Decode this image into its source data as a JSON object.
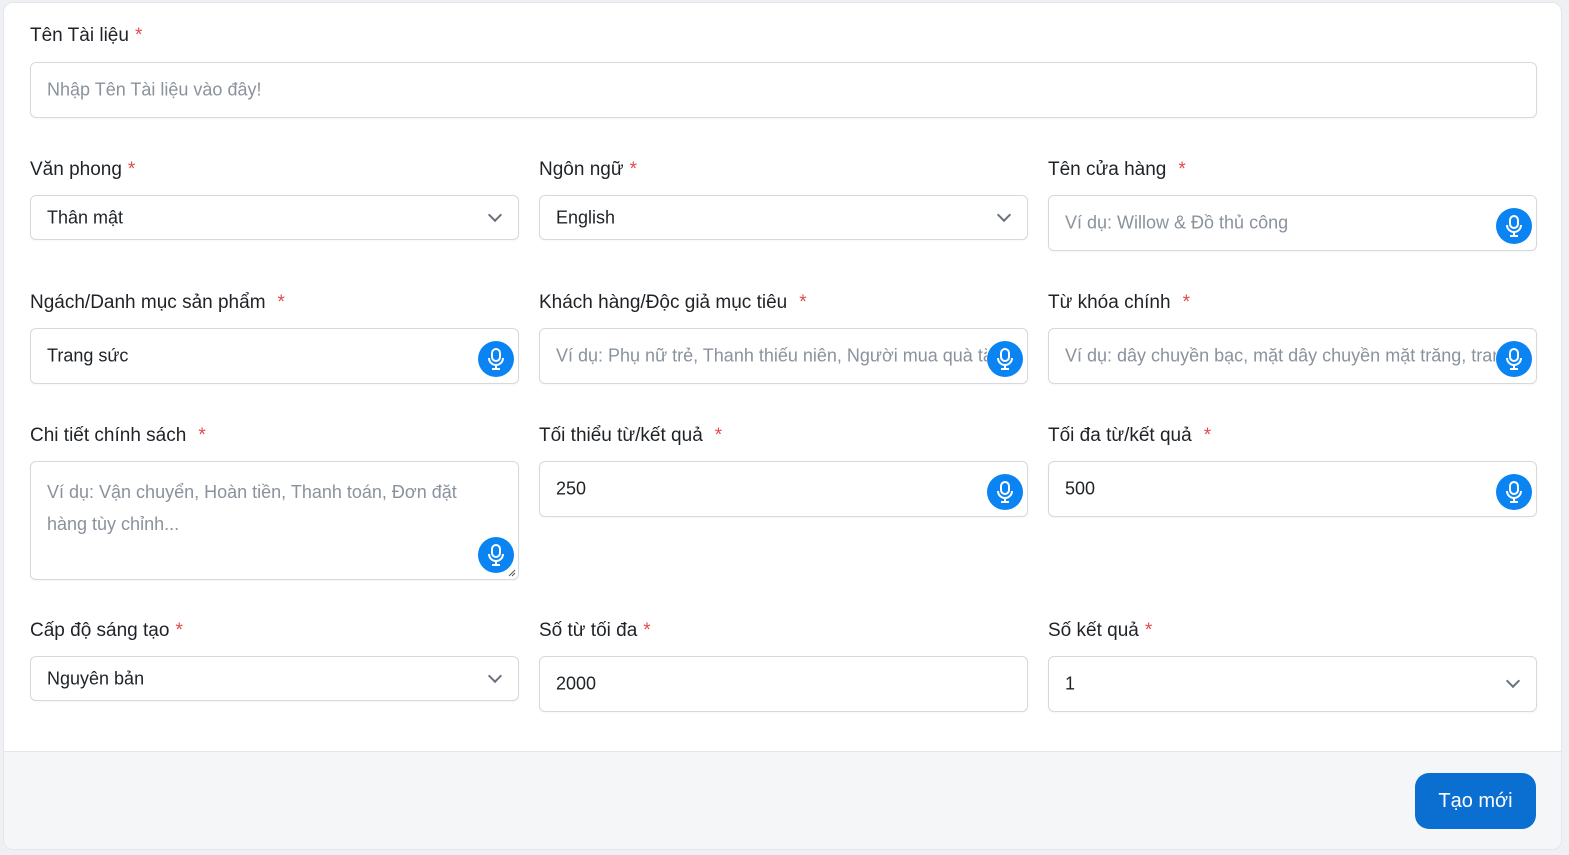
{
  "form": {
    "doc_name": {
      "label": "Tên Tài liệu",
      "placeholder": "Nhập Tên Tài liệu vào đây!"
    },
    "style": {
      "label": "Văn phong",
      "value": "Thân mật"
    },
    "language": {
      "label": "Ngôn ngữ",
      "value": "English"
    },
    "store_name": {
      "label": "Tên cửa hàng",
      "placeholder": "Ví dụ: Willow & Đồ thủ công"
    },
    "niche": {
      "label": "Ngách/Danh mục sản phẩm",
      "value": "Trang sức"
    },
    "audience": {
      "label": "Khách hàng/Độc giả mục tiêu",
      "placeholder": "Ví dụ: Phụ nữ trẻ, Thanh thiếu niên, Người mua quà tặng"
    },
    "keywords": {
      "label": "Từ khóa chính",
      "placeholder": "Ví dụ: dây chuyền bạc, mặt dây chuyền mặt trăng, trang sức tối giản"
    },
    "policy": {
      "label": "Chi tiết chính sách",
      "placeholder": "Ví dụ: Vận chuyển, Hoàn tiền, Thanh toán, Đơn đặt hàng tùy chỉnh..."
    },
    "min_words": {
      "label": "Tối thiểu từ/kết quả",
      "value": "250"
    },
    "max_words": {
      "label": "Tối đa từ/kết quả",
      "value": "500"
    },
    "creativity": {
      "label": "Cấp độ sáng tạo",
      "value": "Nguyên bản"
    },
    "max_total": {
      "label": "Số từ tối đa",
      "value": "2000"
    },
    "results": {
      "label": "Số kết quả",
      "value": "1"
    },
    "required_mark": "*"
  },
  "footer": {
    "create_label": "Tạo mới"
  },
  "icons": {
    "mic": "microphone-icon",
    "chevron": "chevron-down-icon"
  },
  "colors": {
    "accent": "#0b84f3",
    "button": "#0a6fd0",
    "required": "#e5484d"
  }
}
